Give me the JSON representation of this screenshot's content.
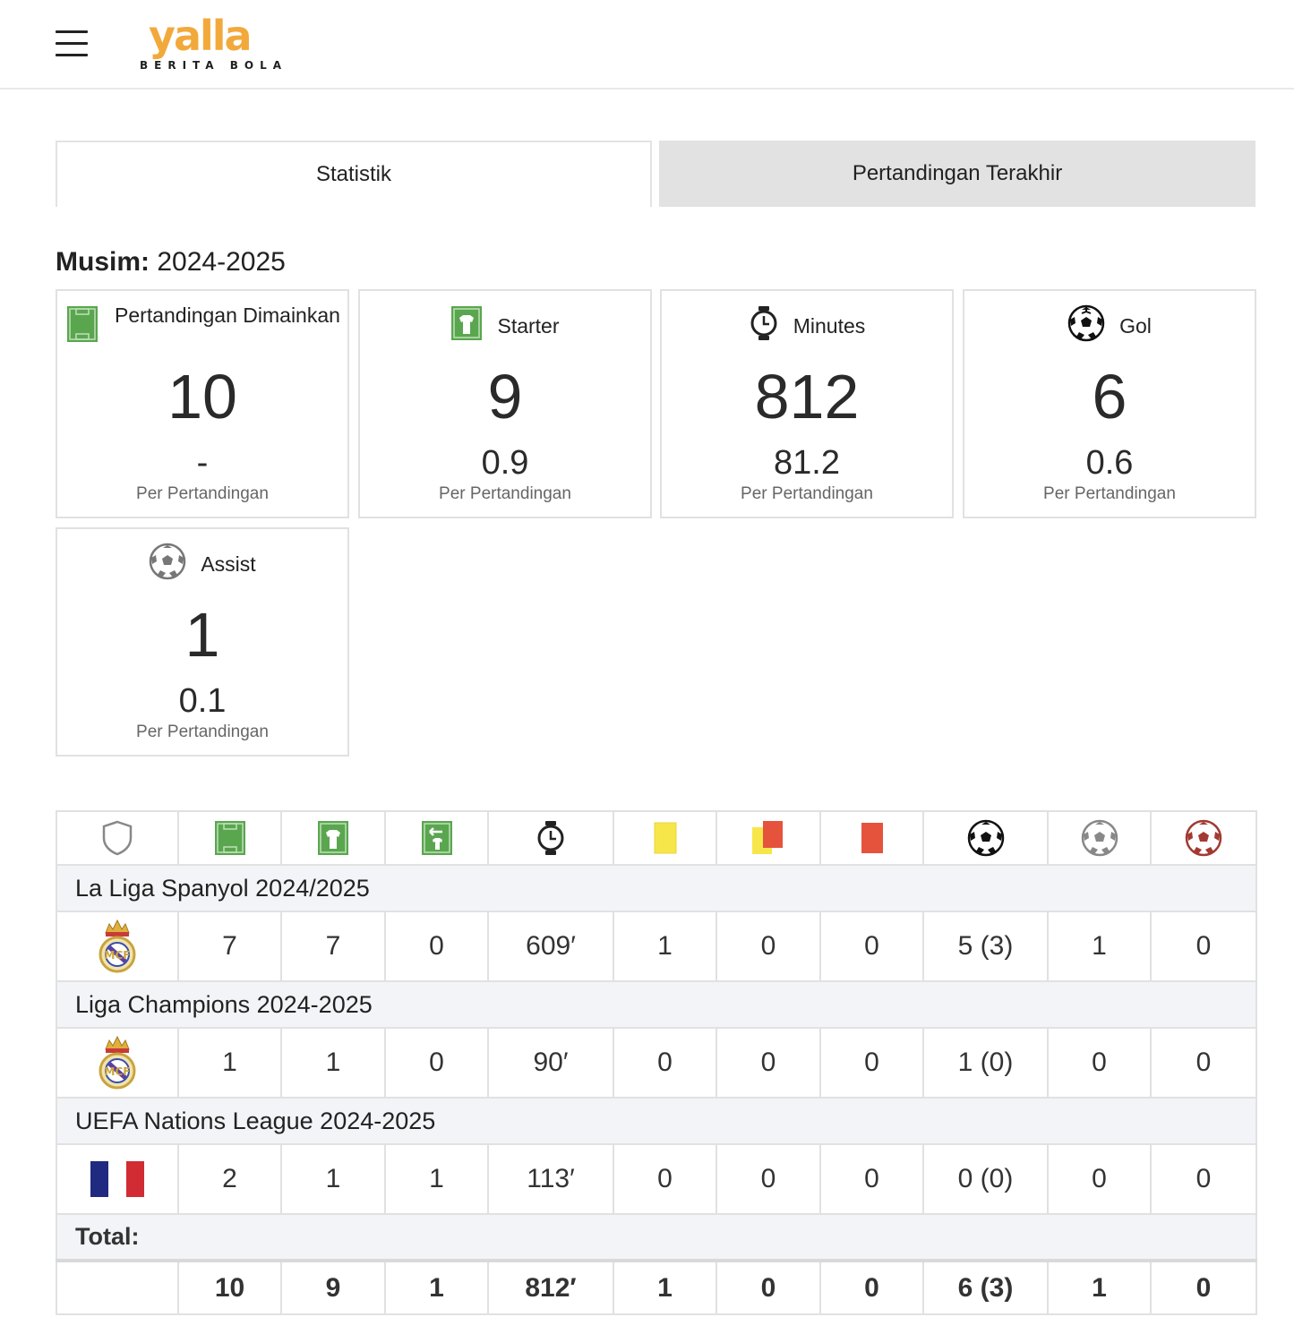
{
  "header": {
    "logo_word": "yalla",
    "logo_sub": "BERITA BOLA"
  },
  "tabs": [
    {
      "label": "Statistik",
      "active": true
    },
    {
      "label": "Pertandingan Terakhir",
      "active": false
    }
  ],
  "season": {
    "label": "Musim:",
    "value": "2024-2025"
  },
  "cards": [
    {
      "label": "Pertandingan Dimainkan",
      "icon": "pitch-icon",
      "value": "10",
      "avg": "-",
      "per": "Per Pertandingan"
    },
    {
      "label": "Starter",
      "icon": "shirt-icon",
      "value": "9",
      "avg": "0.9",
      "per": "Per Pertandingan"
    },
    {
      "label": "Minutes",
      "icon": "stopwatch-icon",
      "value": "812",
      "avg": "81.2",
      "per": "Per Pertandingan"
    },
    {
      "label": "Gol",
      "icon": "ball-icon",
      "value": "6",
      "avg": "0.6",
      "per": "Per Pertandingan"
    },
    {
      "label": "Assist",
      "icon": "ball-assist-icon",
      "value": "1",
      "avg": "0.1",
      "per": "Per Pertandingan"
    }
  ],
  "table": {
    "header_icons": [
      "shield-icon",
      "pitch-icon",
      "shirt-icon",
      "substitution-icon",
      "stopwatch-icon",
      "yellow-card-icon",
      "second-yellow-card-icon",
      "red-card-icon",
      "ball-icon",
      "ball-assist-icon",
      "own-goal-icon"
    ],
    "competitions": [
      {
        "name": "La Liga Spanyol 2024/2025",
        "team_icon": "real-madrid-crest-icon",
        "values": [
          "7",
          "7",
          "0",
          "609′",
          "1",
          "0",
          "0",
          "5 (3)",
          "1",
          "0"
        ]
      },
      {
        "name": "Liga Champions 2024-2025",
        "team_icon": "real-madrid-crest-icon",
        "values": [
          "1",
          "1",
          "0",
          "90′",
          "0",
          "0",
          "0",
          "1 (0)",
          "0",
          "0"
        ]
      },
      {
        "name": "UEFA Nations League 2024-2025",
        "team_icon": "france-flag-icon",
        "values": [
          "2",
          "1",
          "1",
          "113′",
          "0",
          "0",
          "0",
          "0 (0)",
          "0",
          "0"
        ]
      }
    ],
    "total_label": "Total:",
    "total_values": [
      "10",
      "9",
      "1",
      "812′",
      "1",
      "0",
      "0",
      "6 (3)",
      "1",
      "0"
    ]
  },
  "colors": {
    "brand": "#f2a93b",
    "pitch_green": "#5aa64f",
    "yellow_card": "#f7e64a",
    "red_card": "#e5533d",
    "tab_inactive": "#e2e2e2",
    "row_band": "#f2f4f7"
  }
}
